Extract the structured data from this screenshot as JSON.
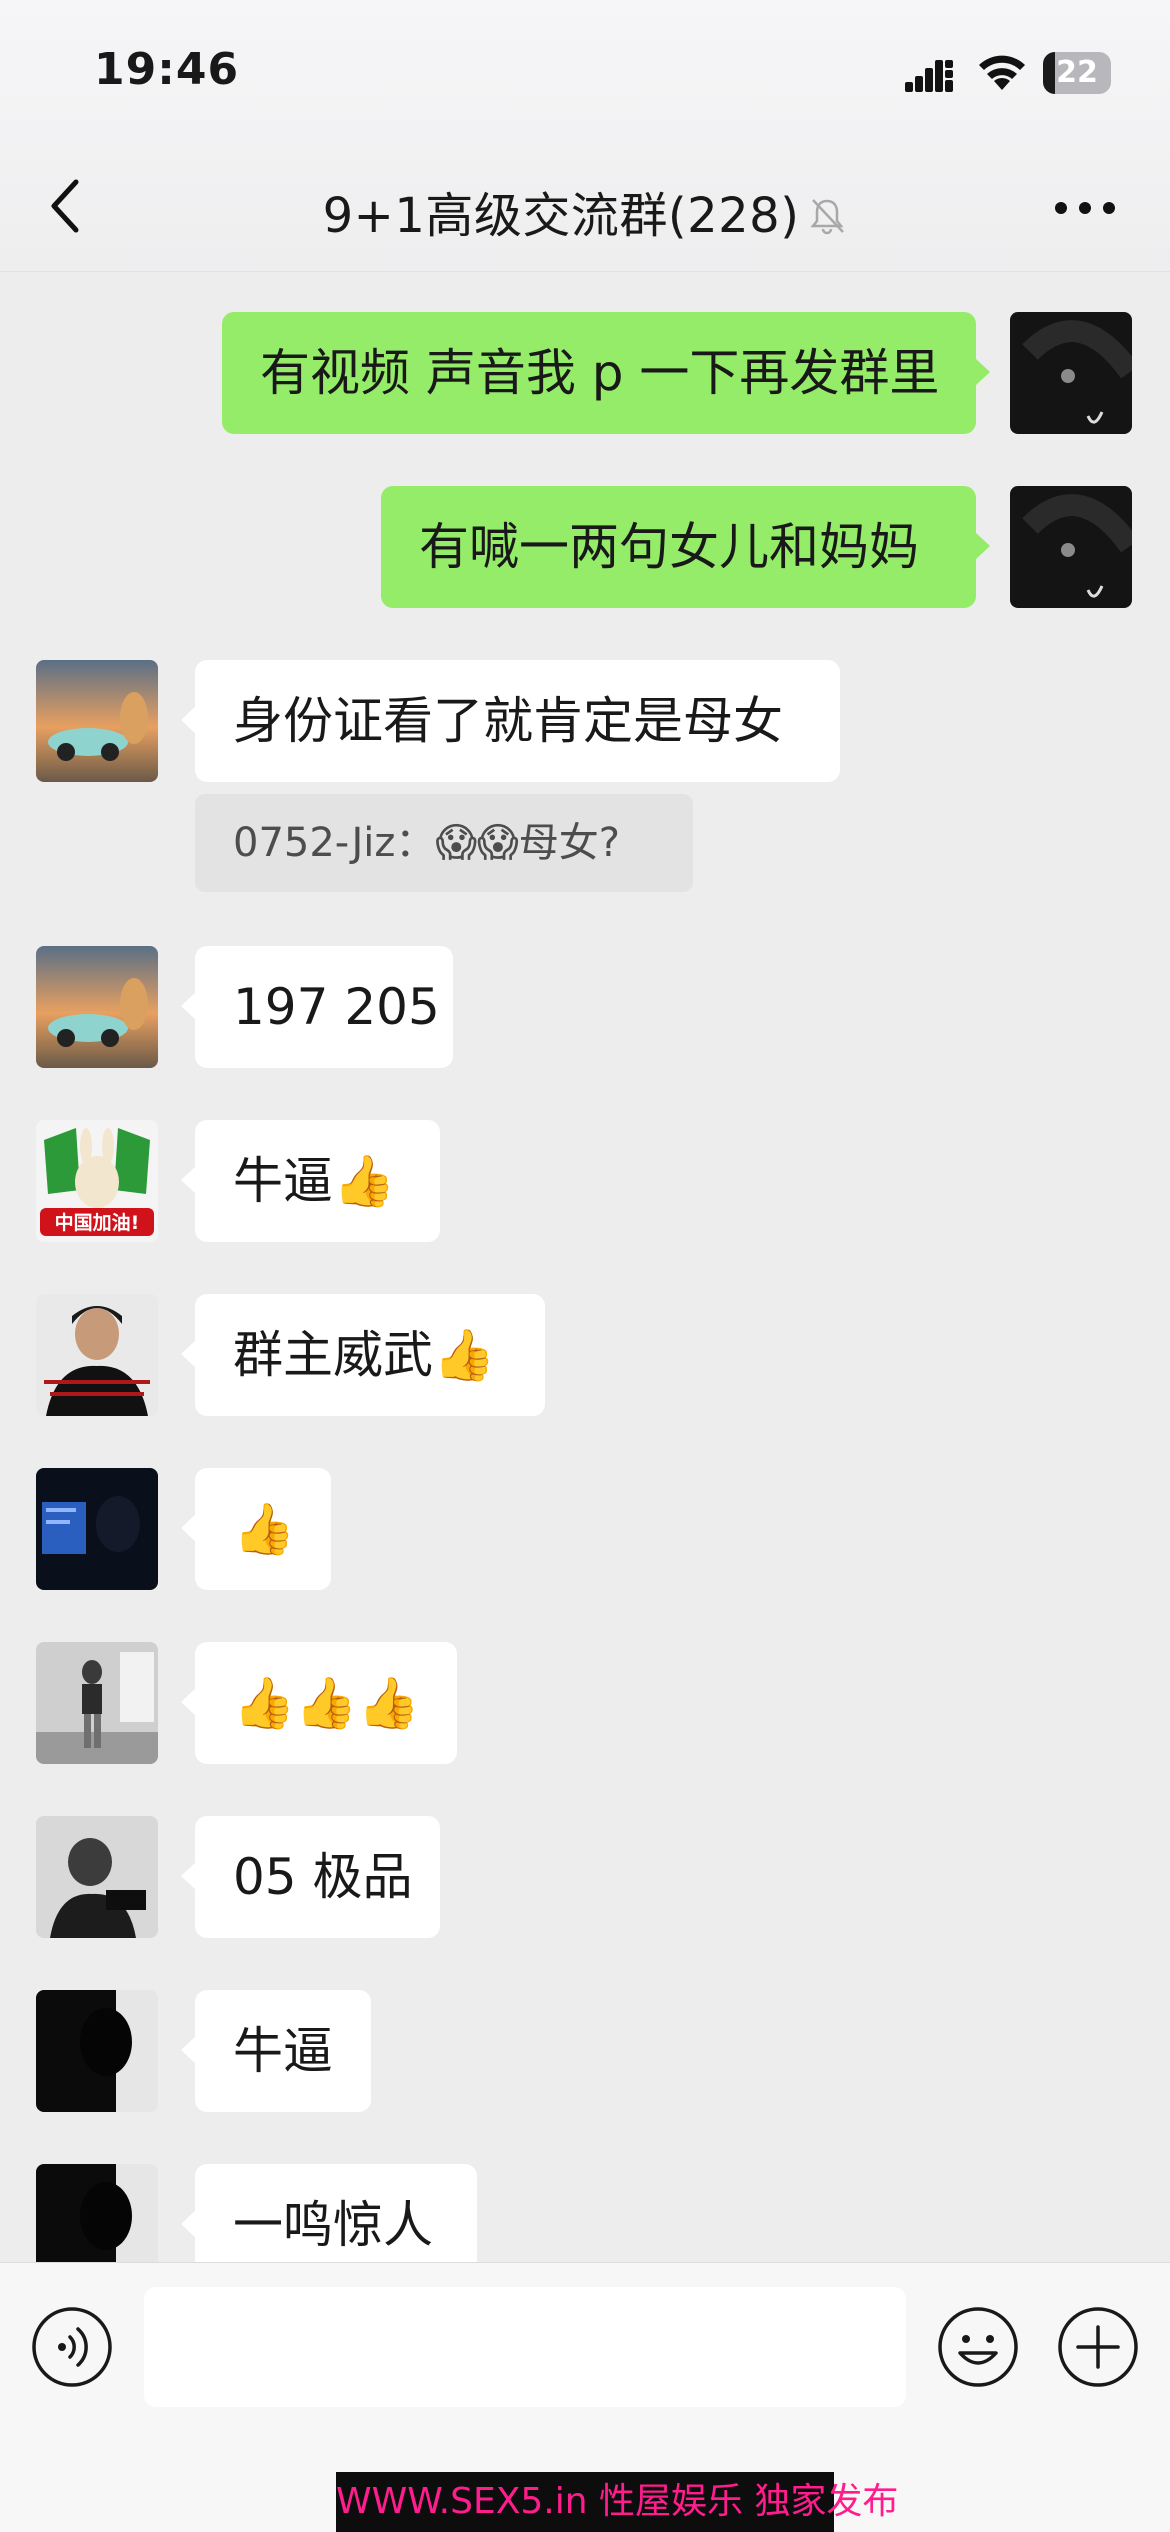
{
  "status_bar": {
    "time": "19:46",
    "battery": "22"
  },
  "nav": {
    "title": "9+1高级交流群(228)"
  },
  "messages": [
    {
      "text": "有视频 声音我 p 一下再发群里"
    },
    {
      "text": "有喊一两句女儿和妈妈"
    },
    {
      "text": "身份证看了就肯定是母女",
      "quote": "0752-Jiz：😱😱母女?"
    },
    {
      "text": "197 205"
    },
    {
      "text": "牛逼👍"
    },
    {
      "text": "群主威武👍"
    },
    {
      "text": "👍"
    },
    {
      "text": "👍👍👍"
    },
    {
      "text": "05 极品"
    },
    {
      "text": "牛逼"
    },
    {
      "text": "一鸣惊人"
    }
  ],
  "avatars": {
    "cn_badge_text": "中国加油!"
  },
  "input": {
    "placeholder": ""
  },
  "watermark": "WWW.SEX5.in 性屋娱乐 独家发布",
  "colors": {
    "outgoing_bubble": "#95ec69",
    "incoming_bubble": "#ffffff",
    "chat_background": "#ededed"
  }
}
